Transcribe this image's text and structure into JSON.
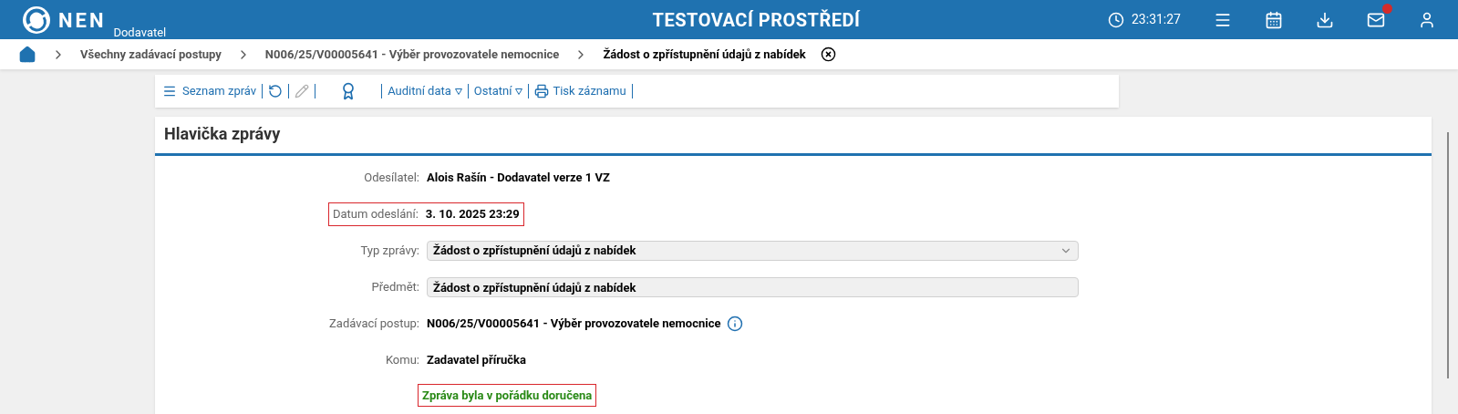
{
  "header": {
    "logo_text": "NEN",
    "logo_sub": "Dodavatel",
    "title": "TESTOVACÍ PROSTŘEDÍ",
    "time": "23:31:27",
    "mail_unread": true
  },
  "breadcrumbs": [
    {
      "label": "Všechny zadávací postupy",
      "current": false
    },
    {
      "label": "N006/25/V00005641 - Výběr provozovatele nemocnice",
      "current": false
    },
    {
      "label": "Žádost o zpřístupnění údajů z nabídek",
      "current": true
    }
  ],
  "toolbar": [
    {
      "kind": "menu",
      "label": "Seznam zpráv",
      "disabled": false
    },
    {
      "kind": "refresh",
      "disabled": false
    },
    {
      "kind": "edit",
      "disabled": true
    },
    {
      "kind": "award",
      "disabled": false
    },
    {
      "kind": "dropdown",
      "label": "Auditní data",
      "disabled": false
    },
    {
      "kind": "dropdown",
      "label": "Ostatní",
      "disabled": false
    },
    {
      "kind": "print",
      "label": "Tisk záznamu",
      "disabled": false
    }
  ],
  "section": {
    "title": "Hlavička zprávy"
  },
  "fields": [
    {
      "kind": "text",
      "label": "Odesílatel:",
      "value": "Alois Rašín - Dodavatel verze 1 VZ",
      "highlighted": false
    },
    {
      "kind": "text",
      "label": "Datum odeslání:",
      "value": "3. 10. 2025 23:29",
      "highlighted": true
    },
    {
      "kind": "select",
      "label": "Typ zprávy:",
      "value": "Žádost o zpřístupnění údajů z nabídek",
      "highlighted": false
    },
    {
      "kind": "input",
      "label": "Předmět:",
      "value": "Žádost o zpřístupnění údajů z nabídek",
      "highlighted": false
    },
    {
      "kind": "info",
      "label": "Zadávací postup:",
      "value": "N006/25/V00005641 - Výběr provozovatele nemocnice",
      "highlighted": false
    },
    {
      "kind": "text",
      "label": "Komu:",
      "value": "Zadavatel příručka",
      "highlighted": false
    }
  ],
  "status": {
    "text": "Zpráva byla v pořádku doručena",
    "highlighted": true
  }
}
